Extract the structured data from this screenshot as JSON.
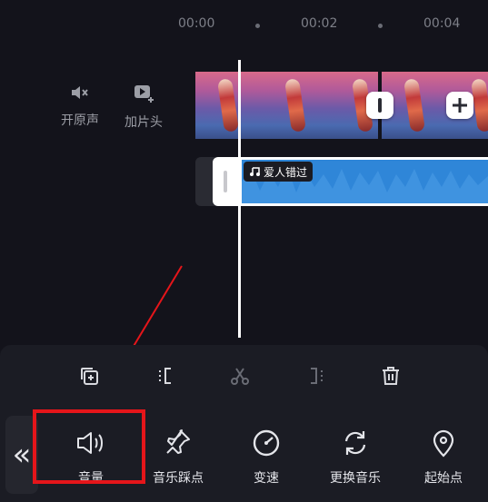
{
  "timeline": {
    "times": [
      "00:00",
      "00:02",
      "00:04"
    ]
  },
  "side_buttons": {
    "original_sound": "开原声",
    "add_intro": "加片头"
  },
  "audio": {
    "music_name": "爱人错过"
  },
  "edit_toolbar": {
    "icons": [
      "copy-icon",
      "split-left-icon",
      "scissors-icon",
      "split-right-icon",
      "trash-icon"
    ]
  },
  "menu": {
    "back_label": "«",
    "items": [
      {
        "label": "音量",
        "icon": "volume-icon"
      },
      {
        "label": "音乐踩点",
        "icon": "pin-icon"
      },
      {
        "label": "变速",
        "icon": "speedometer-icon"
      },
      {
        "label": "更换音乐",
        "icon": "refresh-icon"
      },
      {
        "label": "起始点",
        "icon": "location-icon"
      }
    ]
  },
  "colors": {
    "background": "#13131b",
    "panel": "#1b1c24",
    "audio_wave": "#2f86d8",
    "annotation": "#e5151a"
  }
}
